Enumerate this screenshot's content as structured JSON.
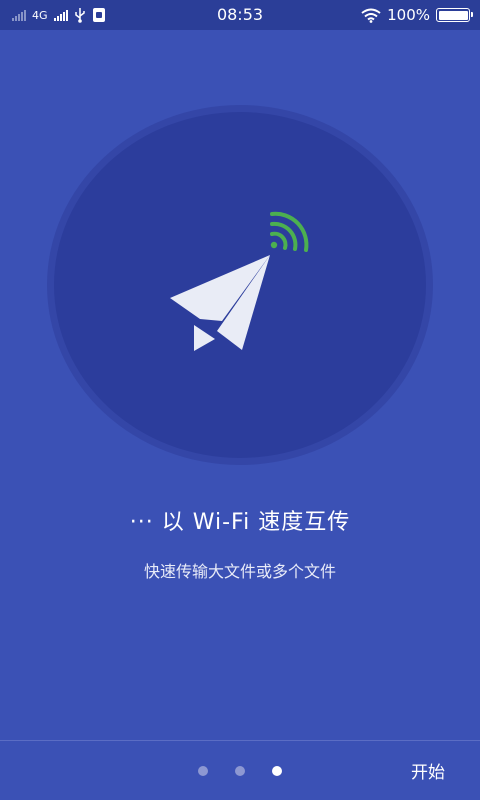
{
  "status_bar": {
    "network_type": "4G",
    "time": "08:53",
    "battery_percent": "100%",
    "battery_level": 1.0,
    "icons": [
      "signal-icon",
      "usb-icon",
      "notification-icon",
      "wifi-icon",
      "battery-icon"
    ]
  },
  "intro": {
    "title": "··· 以 Wi-Fi 速度互传",
    "subtitle": "快速传输大文件或多个文件"
  },
  "pager": {
    "total": 3,
    "current": 3
  },
  "footer": {
    "start_label": "开始"
  },
  "colors": {
    "background": "#3b51b5",
    "status_bar": "#2b3e98",
    "circle": "#2c3d9c",
    "wifi_green": "#4caf50",
    "plane": "#e9ecf6"
  }
}
